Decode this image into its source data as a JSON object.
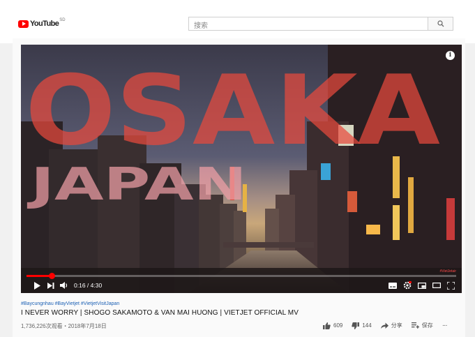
{
  "masthead": {
    "logo_text": "YouTube",
    "logo_sup": "SD",
    "search_placeholder": "搜索"
  },
  "video": {
    "overlay_title": "OSAKA",
    "overlay_subtitle": "JAPAN",
    "watermark": "#VietJetair",
    "current_time": "0:16",
    "duration": "4:30",
    "progress_fraction": 0.059,
    "time_display": "0:16 / 4:30"
  },
  "meta": {
    "hashtags": "#Baycungnhau #BayVietjet #VietjetVisitJapan",
    "title": "I NEVER WORRY | SHOGO SAKAMOTO & VAN MAI HUONG | VIETJET OFFICIAL MV",
    "views_date": "1,736,226次观看・2018年7月18日"
  },
  "actions": {
    "likes": "609",
    "dislikes": "144",
    "share": "分享",
    "save": "保存",
    "more": "···"
  },
  "colors": {
    "brand_red": "#ff0000",
    "overlay_red": "#e8493d",
    "link_blue": "#1a5fb4"
  }
}
